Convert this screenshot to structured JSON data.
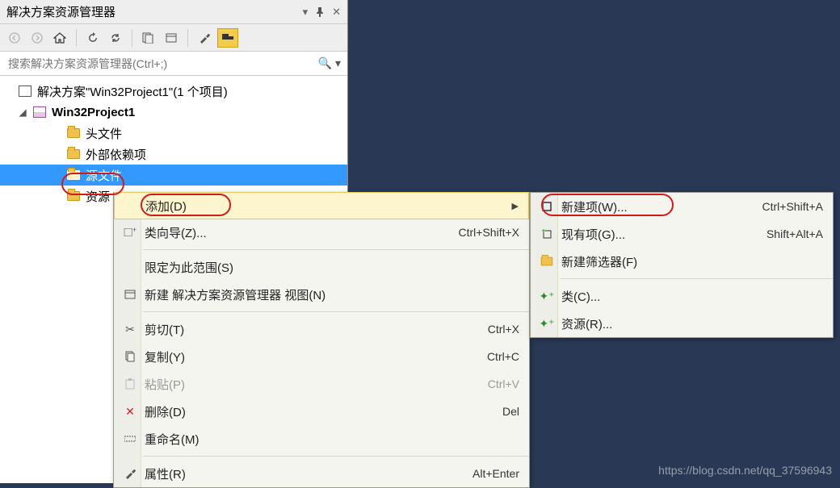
{
  "panel": {
    "title": "解决方案资源管理器",
    "search_placeholder": "搜索解决方案资源管理器(Ctrl+;)"
  },
  "tree": {
    "solution": "解决方案\"Win32Project1\"(1 个项目)",
    "project": "Win32Project1",
    "folders": {
      "headers": "头文件",
      "external": "外部依赖项",
      "source": "源文件",
      "resources": "资源"
    }
  },
  "menu1": {
    "add": "添加(D)",
    "classwiz": "类向导(Z)...",
    "classwiz_sc": "Ctrl+Shift+X",
    "scope": "限定为此范围(S)",
    "newview": "新建 解决方案资源管理器 视图(N)",
    "cut": "剪切(T)",
    "cut_sc": "Ctrl+X",
    "copy": "复制(Y)",
    "copy_sc": "Ctrl+C",
    "paste": "粘贴(P)",
    "paste_sc": "Ctrl+V",
    "delete": "删除(D)",
    "delete_sc": "Del",
    "rename": "重命名(M)",
    "props": "属性(R)",
    "props_sc": "Alt+Enter"
  },
  "menu2": {
    "newitem": "新建项(W)...",
    "newitem_sc": "Ctrl+Shift+A",
    "existing": "现有项(G)...",
    "existing_sc": "Shift+Alt+A",
    "newfilter": "新建筛选器(F)",
    "class": "类(C)...",
    "resource": "资源(R)..."
  },
  "watermark": "https://blog.csdn.net/qq_37596943"
}
